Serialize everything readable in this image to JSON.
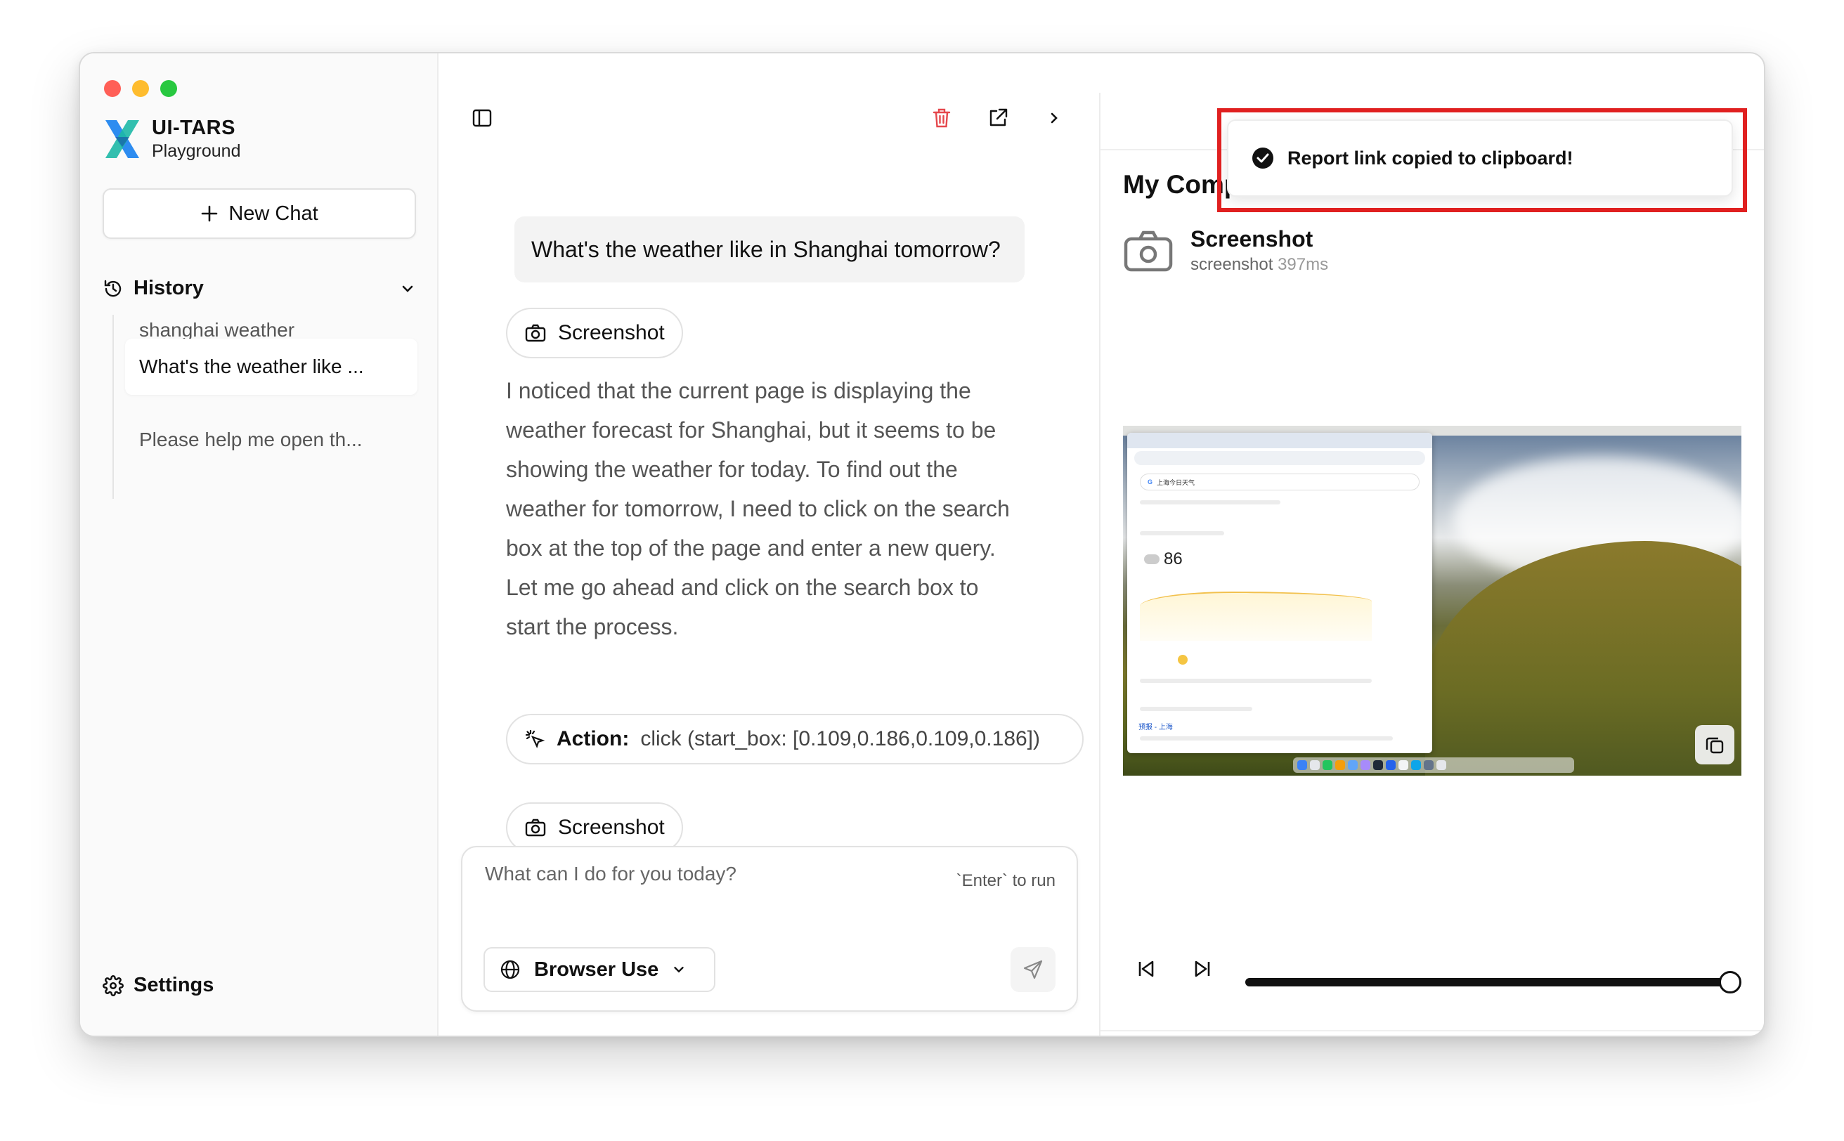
{
  "brand": {
    "title": "UI-TARS",
    "subtitle": "Playground"
  },
  "sidebar": {
    "new_chat_label": "New Chat",
    "history_label": "History",
    "history_items": [
      {
        "label": "shanghai weather"
      },
      {
        "label": "What's the weather like ..."
      },
      {
        "label": "Please help me open th..."
      }
    ],
    "settings_label": "Settings"
  },
  "chat": {
    "user_message": "What's the weather like in Shanghai tomorrow?",
    "screenshot_label": "Screenshot",
    "ai_text_lines": [
      "I noticed that the current page is displaying the",
      "weather forecast for Shanghai, but it seems to be",
      "showing the weather for today. To find out the",
      "weather for tomorrow, I need to click on the search",
      "box at the top of the page and enter a new query.",
      "Let me go ahead and click on the search box to",
      "start the process."
    ],
    "action_label": "Action:",
    "action_value": "click (start_box: [0.109,0.186,0.109,0.186])",
    "screenshot_label_2": "Screenshot"
  },
  "input": {
    "placeholder": "What can I do for you today?",
    "hint": "`Enter` to run",
    "mode_label": "Browser Use"
  },
  "panel": {
    "title": "My Comp",
    "step_title": "Screenshot",
    "step_type": "screenshot",
    "step_duration": "397ms",
    "playback_progress": 1.0,
    "mini_search_text": "上海今日天气",
    "mini_temp": "86",
    "mini_link": "预报 - 上海"
  },
  "toast": {
    "message": "Report link copied to clipboard!"
  },
  "colors": {
    "accent_blue": "#1f6fe5",
    "danger": "#e5484d",
    "highlight": "#e02020"
  }
}
